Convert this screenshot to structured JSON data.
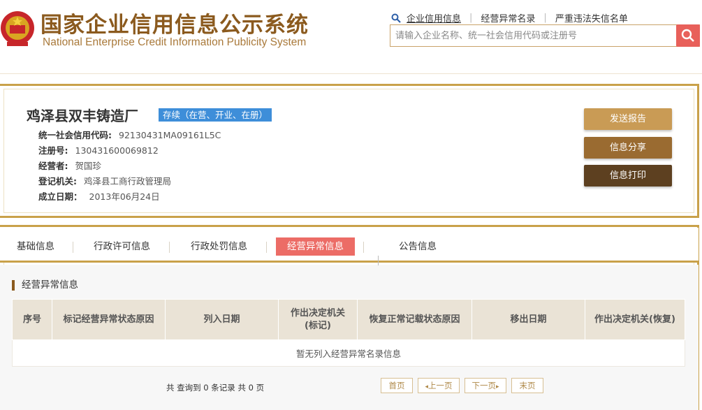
{
  "header": {
    "title_cn": "国家企业信用信息公示系统",
    "title_en": "National Enterprise Credit Information Publicity System",
    "links": [
      "企业信用信息",
      "经营异常名录",
      "严重违法失信名单"
    ],
    "search_placeholder": "请输入企业名称、统一社会信用代码或注册号"
  },
  "company": {
    "name": "鸡泽县双丰铸造厂",
    "status": "存续（在营、开业、在册）",
    "fields": [
      {
        "label": "统一社会信用代码:",
        "value": "92130431MA09161L5C"
      },
      {
        "label": "注册号:",
        "value": "130431600069812"
      },
      {
        "label": "经营者:",
        "value": "贺国珍"
      },
      {
        "label": "登记机关:",
        "value": "鸡泽县工商行政管理局"
      },
      {
        "label": "成立日期：",
        "value": "2013年06月24日"
      }
    ]
  },
  "actions": {
    "report": "发送报告",
    "share": "信息分享",
    "print": "信息打印"
  },
  "tabs": [
    "基础信息",
    "行政许可信息",
    "行政处罚信息",
    "经营异常信息",
    "公告信息"
  ],
  "active_tab": "经营异常信息",
  "section": {
    "title": "经营异常信息",
    "columns": [
      "序号",
      "标记经营异常状态原因",
      "列入日期",
      "作出决定机关(标记)",
      "恢复正常记载状态原因",
      "移出日期",
      "作出决定机关(恢复)"
    ],
    "empty_text": "暂无列入经营异常名录信息"
  },
  "pager": {
    "summary": "共 查询到 0 条记录 共 0 页",
    "first": "首页",
    "prev": "上一页",
    "next": "下一页",
    "last": "末页"
  },
  "colors": {
    "brand_brown": "#8b5a1e",
    "gold_border": "#c9a14a",
    "active_tab": "#ec6c66",
    "status_blue": "#3e8ed9",
    "search_red": "#e8605a"
  }
}
